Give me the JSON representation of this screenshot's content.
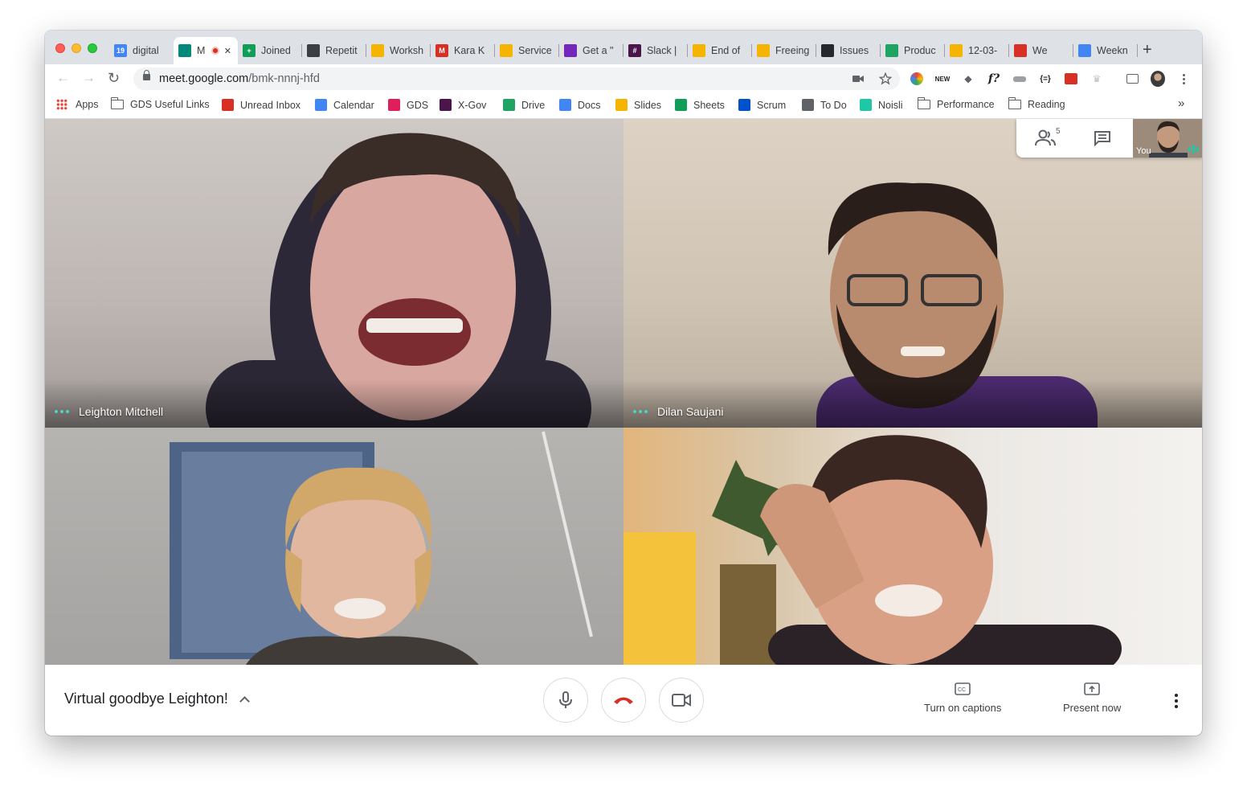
{
  "browser": {
    "tabs": [
      {
        "title": "digital",
        "fav_color": "#4285f4",
        "fav_text": "19"
      },
      {
        "title": "M",
        "fav_color": "#00897b",
        "fav_text": ""
      },
      {
        "title": "Joined",
        "fav_color": "#0f9d58",
        "fav_text": "+"
      },
      {
        "title": "Repetit",
        "fav_color": "#3c4043",
        "fav_text": ""
      },
      {
        "title": "Worksh",
        "fav_color": "#f4b400",
        "fav_text": ""
      },
      {
        "title": "Kara K",
        "fav_color": "#d93025",
        "fav_text": "M"
      },
      {
        "title": "Service",
        "fav_color": "#f4b400",
        "fav_text": ""
      },
      {
        "title": "Get a \"",
        "fav_color": "#7627bb",
        "fav_text": ""
      },
      {
        "title": "Slack |",
        "fav_color": "#4a154b",
        "fav_text": "#"
      },
      {
        "title": "End of",
        "fav_color": "#f4b400",
        "fav_text": ""
      },
      {
        "title": "Freeing",
        "fav_color": "#f4b400",
        "fav_text": ""
      },
      {
        "title": "Issues",
        "fav_color": "#24292e",
        "fav_text": ""
      },
      {
        "title": "Produc",
        "fav_color": "#1fa463",
        "fav_text": ""
      },
      {
        "title": "12-03-",
        "fav_color": "#f4b400",
        "fav_text": ""
      },
      {
        "title": "We",
        "fav_color": "#d93025",
        "fav_text": ""
      },
      {
        "title": "Weekn",
        "fav_color": "#4285f4",
        "fav_text": ""
      }
    ],
    "new_tab_label": "+",
    "url_host": "meet.google.com",
    "url_path": "/bmk-nnnj-hfd",
    "bookmarks": [
      {
        "label": "Apps",
        "kind": "apps"
      },
      {
        "label": "GDS Useful Links",
        "kind": "folder"
      },
      {
        "label": "Unread Inbox",
        "kind": "gmail"
      },
      {
        "label": "Calendar",
        "kind": "calendar"
      },
      {
        "label": "GDS",
        "kind": "slack"
      },
      {
        "label": "X-Gov",
        "kind": "xgov"
      },
      {
        "label": "Drive",
        "kind": "drive"
      },
      {
        "label": "Docs",
        "kind": "docs"
      },
      {
        "label": "Slides",
        "kind": "slides"
      },
      {
        "label": "Sheets",
        "kind": "sheets"
      },
      {
        "label": "Scrum",
        "kind": "scrum"
      },
      {
        "label": "To Do",
        "kind": "trello"
      },
      {
        "label": "Noisli",
        "kind": "noisli"
      },
      {
        "label": "Performance",
        "kind": "folder"
      },
      {
        "label": "Reading",
        "kind": "folder"
      }
    ],
    "bookmarks_overflow": "»"
  },
  "meet": {
    "participants": [
      {
        "name": "Leighton Mitchell",
        "speaking": true
      },
      {
        "name": "Dilan Saujani",
        "speaking": true
      },
      {
        "name": "",
        "speaking": false
      },
      {
        "name": "",
        "speaking": false
      }
    ],
    "people_count": "5",
    "self_label": "You",
    "meeting_title": "Virtual goodbye Leighton!",
    "captions_label": "Turn on captions",
    "present_label": "Present now"
  }
}
